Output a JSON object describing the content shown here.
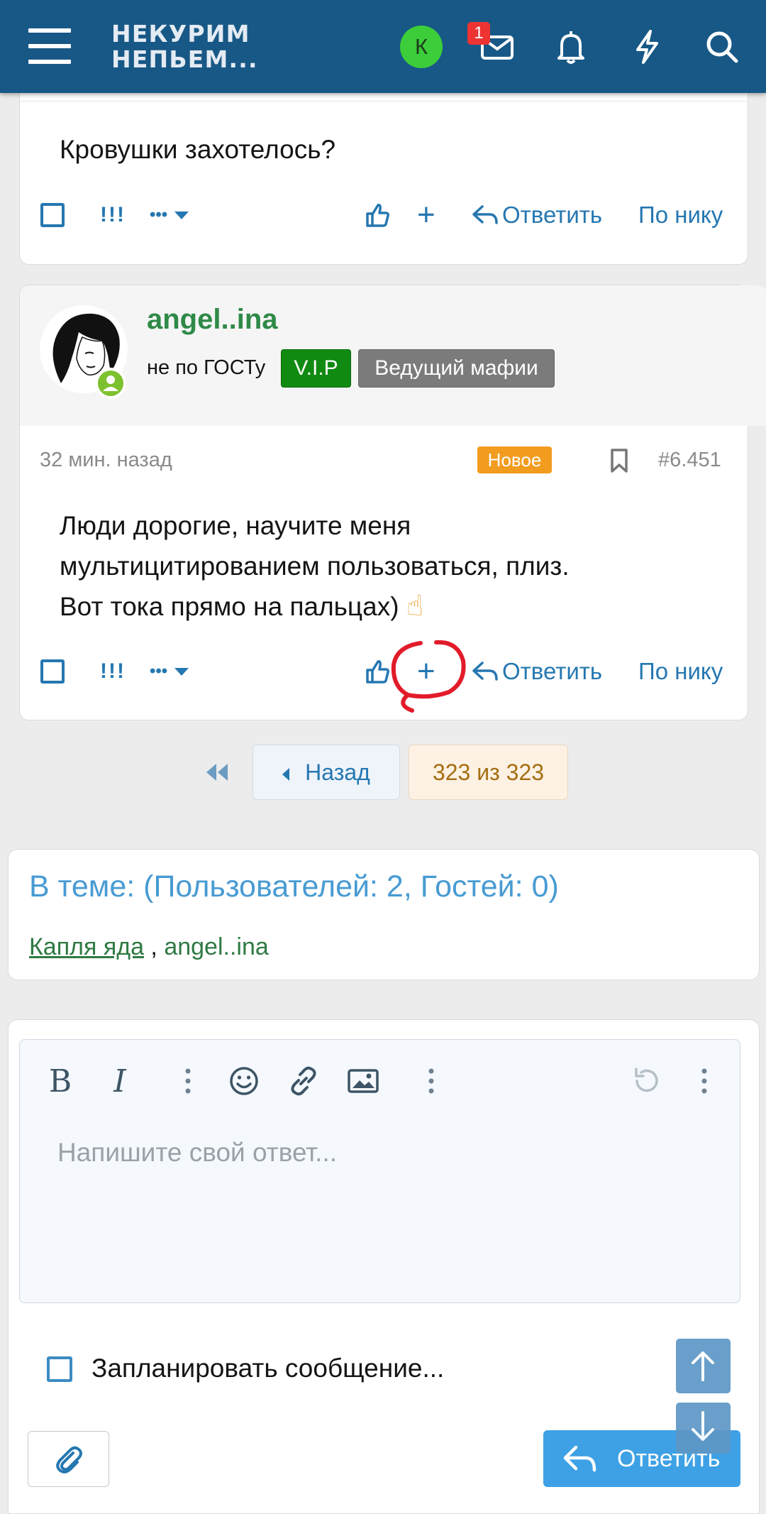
{
  "header": {
    "logo_line1": "НЕКУРИМ",
    "logo_line2": "НЕПЬЕМ...",
    "avatar_letter": "К",
    "inbox_badge": "1",
    "colors": {
      "bar": "#185886",
      "accent": "#2577b1"
    }
  },
  "post1": {
    "text": "Кровушки захотелось?",
    "actions": {
      "report": "!!!",
      "more": "•••",
      "reply": "Ответить",
      "by_nick": "По нику"
    }
  },
  "post2": {
    "username": "angel..ina",
    "user_title": "не по ГОСТу",
    "tags": [
      "V.I.P",
      "Ведущий мафии"
    ],
    "time": "32 мин. назад",
    "new_badge": "Новое",
    "post_number": "#6.451",
    "lines": [
      "Люди дорогие, научите меня",
      "мультицитированием пользоваться, плиз.",
      "Вот тока прямо на пальцах)"
    ],
    "emoji": "☝",
    "actions": {
      "report": "!!!",
      "more": "•••",
      "reply": "Ответить",
      "by_nick": "По нику"
    }
  },
  "pagination": {
    "back": "Назад",
    "page_label": "323 из 323"
  },
  "in_topic": {
    "title": "В теме: (Пользователей: 2, Гостей: 0)",
    "user1": "Капля яда",
    "separator": " , ",
    "user2": "angel..ina"
  },
  "reply_form": {
    "placeholder": "Напишите свой ответ...",
    "schedule_label": "Запланировать сообщение...",
    "submit_label": "Ответить",
    "toolbar_icons": [
      "bold-icon",
      "italic-icon",
      "more-vertical-icon",
      "smiley-icon",
      "link-icon",
      "image-icon",
      "more-vertical-icon",
      "undo-icon",
      "more-vertical-icon"
    ]
  }
}
